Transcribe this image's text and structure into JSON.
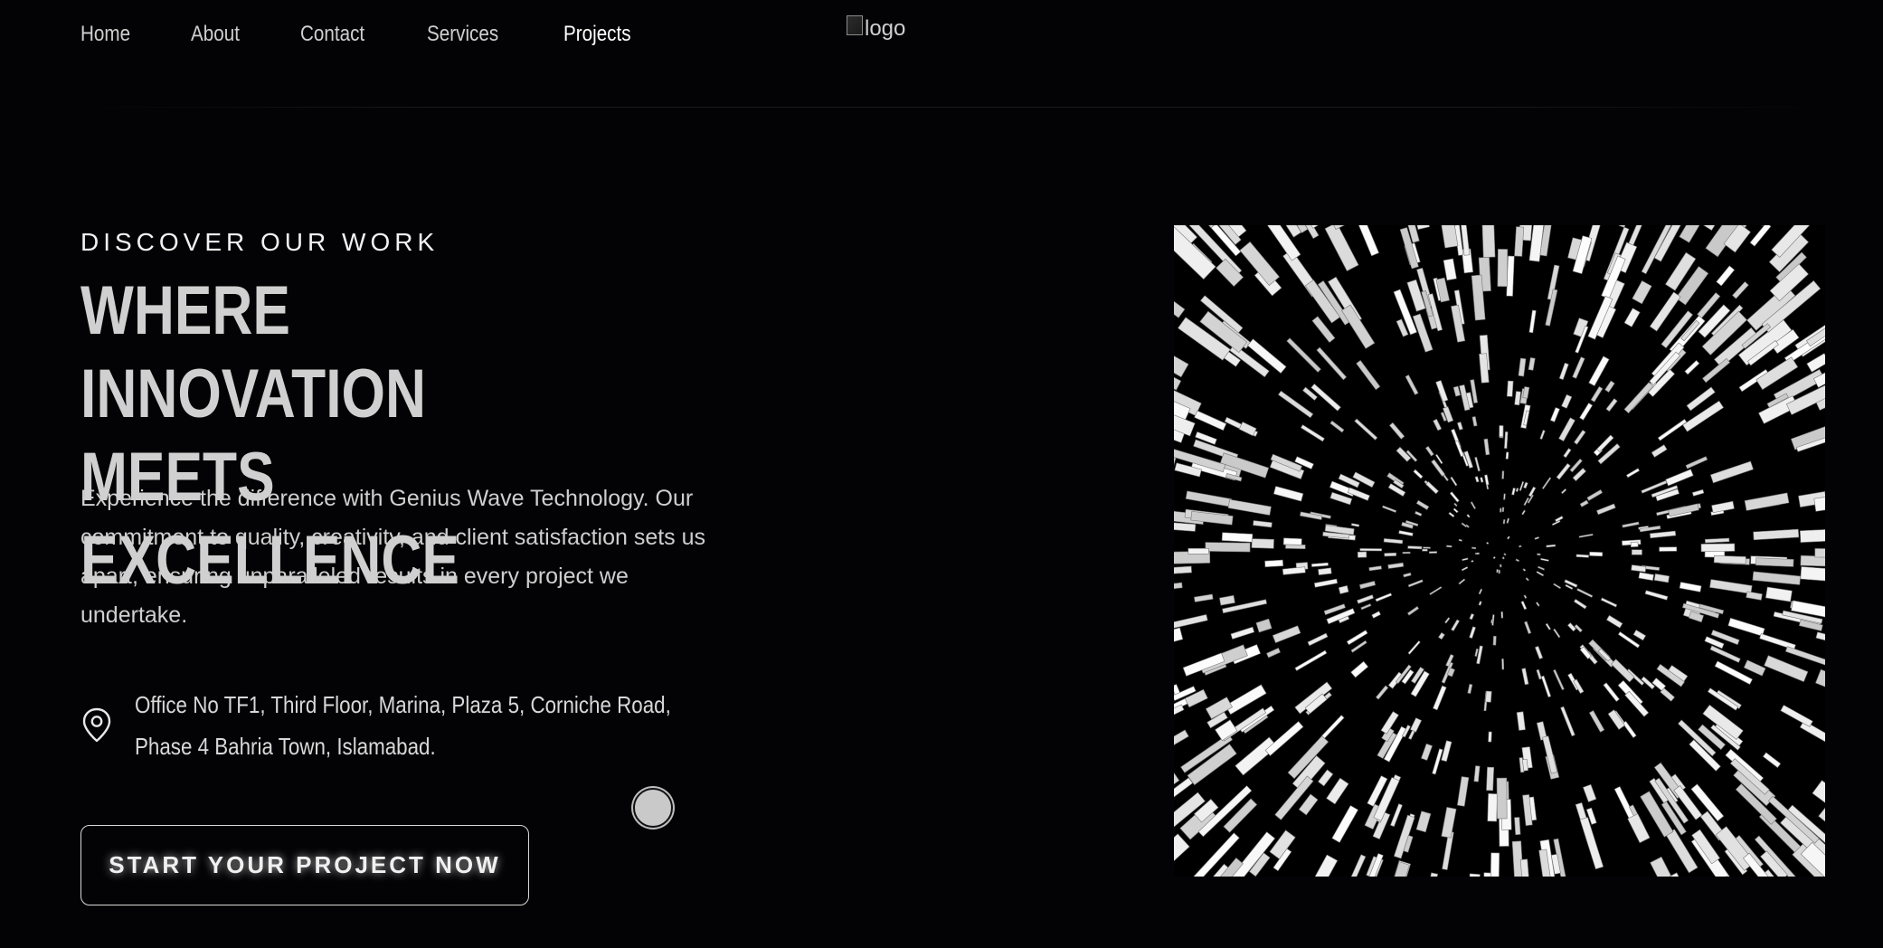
{
  "nav": {
    "links": [
      {
        "label": "Home",
        "active": false
      },
      {
        "label": "About",
        "active": false
      },
      {
        "label": "Contact",
        "active": false
      },
      {
        "label": "Services",
        "active": false
      },
      {
        "label": "Projects",
        "active": true
      }
    ],
    "logo_alt": "logo"
  },
  "hero": {
    "eyebrow": "DISCOVER OUR WORK",
    "headline_line1": "WHERE INNOVATION",
    "headline_line2": "MEETS EXCELLENCE",
    "description": "Experience the difference with Genius Wave Technology. Our commitment to quality, creativity, and client satisfaction sets us apart, ensuring unparalleled results in every project we undertake.",
    "address_line1": "Office No TF1, Third Floor, Marina, Plaza 5, Corniche Road,",
    "address_line2": "Phase 4 Bahria Town, Islamabad.",
    "address_icon": "location-pin-icon",
    "cta_label": "START YOUR PROJECT NOW",
    "image_description_icon": "tunnel-graphic"
  },
  "colors": {
    "background": "#030305",
    "text": "#d0d0d0",
    "accent": "#ffffff"
  }
}
